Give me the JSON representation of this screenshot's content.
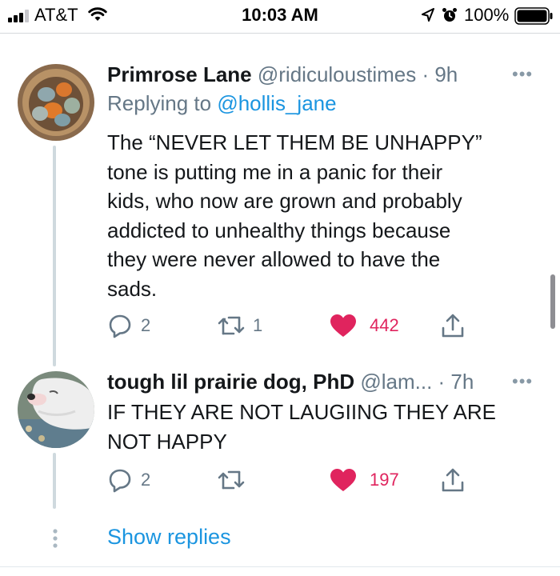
{
  "status_bar": {
    "carrier": "AT&T",
    "time": "10:03 AM",
    "battery": "100%"
  },
  "tweets": [
    {
      "name": "Primrose Lane",
      "handle": "@ridiculoustimes",
      "time": " · 9h",
      "replying_prefix": "Replying to ",
      "replying_to": "@hollis_jane",
      "lines": [
        "The “NEVER LET THEM BE UNHAPPY”",
        "tone is putting me in a panic for their",
        "kids, who now are grown and probably",
        "addicted to unhealthy things because",
        "they were never allowed to have the",
        "sads."
      ],
      "replies": "2",
      "retweets": "1",
      "likes": "442"
    },
    {
      "name": "tough lil prairie dog, PhD",
      "handle": "@lam...",
      "time": " · 7h",
      "lines": [
        "IF THEY ARE NOT LAUGIING THEY ARE",
        "NOT HAPPY"
      ],
      "replies": "2",
      "retweets": "",
      "likes": "197"
    }
  ],
  "show_replies": "Show replies",
  "icons": {
    "more": "more-dots-icon",
    "reply": "reply-bubble-icon",
    "retweet": "retweet-icon",
    "like": "heart-icon",
    "share": "share-icon"
  },
  "colors": {
    "link": "#1b95e0",
    "like": "#e0245e",
    "secondary": "#657786"
  }
}
